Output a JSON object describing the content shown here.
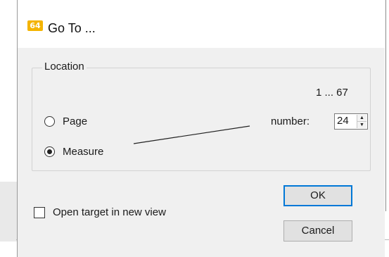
{
  "dialog": {
    "title": "Go To ...",
    "app_icon_text": "64"
  },
  "location": {
    "group_label": "Location",
    "range_label": "1 ... 67",
    "options": [
      {
        "label": "Page",
        "selected": false
      },
      {
        "label": "Measure",
        "selected": true
      }
    ],
    "number_label": "number:",
    "number_value": "24"
  },
  "open_in_new_view": {
    "label": "Open target in new view",
    "checked": false
  },
  "buttons": {
    "ok": "OK",
    "cancel": "Cancel"
  },
  "colors": {
    "accent": "#0078d7",
    "icon": "#f4b400"
  }
}
